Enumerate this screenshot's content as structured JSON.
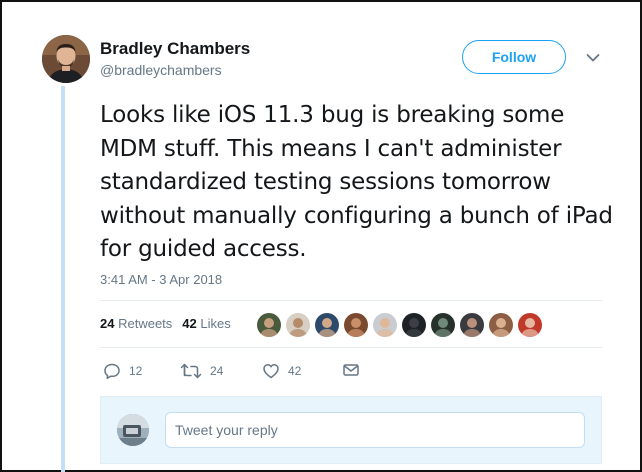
{
  "author": {
    "name": "Bradley Chambers",
    "handle": "@bradleychambers",
    "avatar_icon": "user-avatar"
  },
  "header": {
    "follow_label": "Follow",
    "more_icon": "chevron-down-icon",
    "accent_color": "#1da1f2"
  },
  "tweet": {
    "text": "Looks like iOS 11.3 bug is breaking some MDM stuff. This means I can't administer standardized testing sessions tomorrow without manually configuring a bunch of iPad for guided access.",
    "timestamp": "3:41 AM - 3 Apr 2018"
  },
  "stats": {
    "retweets_count": "24",
    "retweets_label": "Retweets",
    "likes_count": "42",
    "likes_label": "Likes"
  },
  "liker_avatars": [
    {
      "bg": "#4a5a3c",
      "skin": "#c89f7e"
    },
    {
      "bg": "#d7cfc4",
      "skin": "#b58b6a"
    },
    {
      "bg": "#2e4a6a",
      "skin": "#d2a889"
    },
    {
      "bg": "#7a4a30",
      "skin": "#c98f68"
    },
    {
      "bg": "#c9ccd1",
      "skin": "#e0b899"
    },
    {
      "bg": "#1e2226",
      "skin": "#3c4046"
    },
    {
      "bg": "#27312c",
      "skin": "#6f8a7a"
    },
    {
      "bg": "#3b3a3f",
      "skin": "#b99079"
    },
    {
      "bg": "#8c5e45",
      "skin": "#d9b08f"
    },
    {
      "bg": "#c0392b",
      "skin": "#e5b8a0"
    }
  ],
  "actions": {
    "reply_count": "12",
    "retweet_count": "24",
    "like_count": "42"
  },
  "reply": {
    "placeholder": "Tweet your reply"
  }
}
